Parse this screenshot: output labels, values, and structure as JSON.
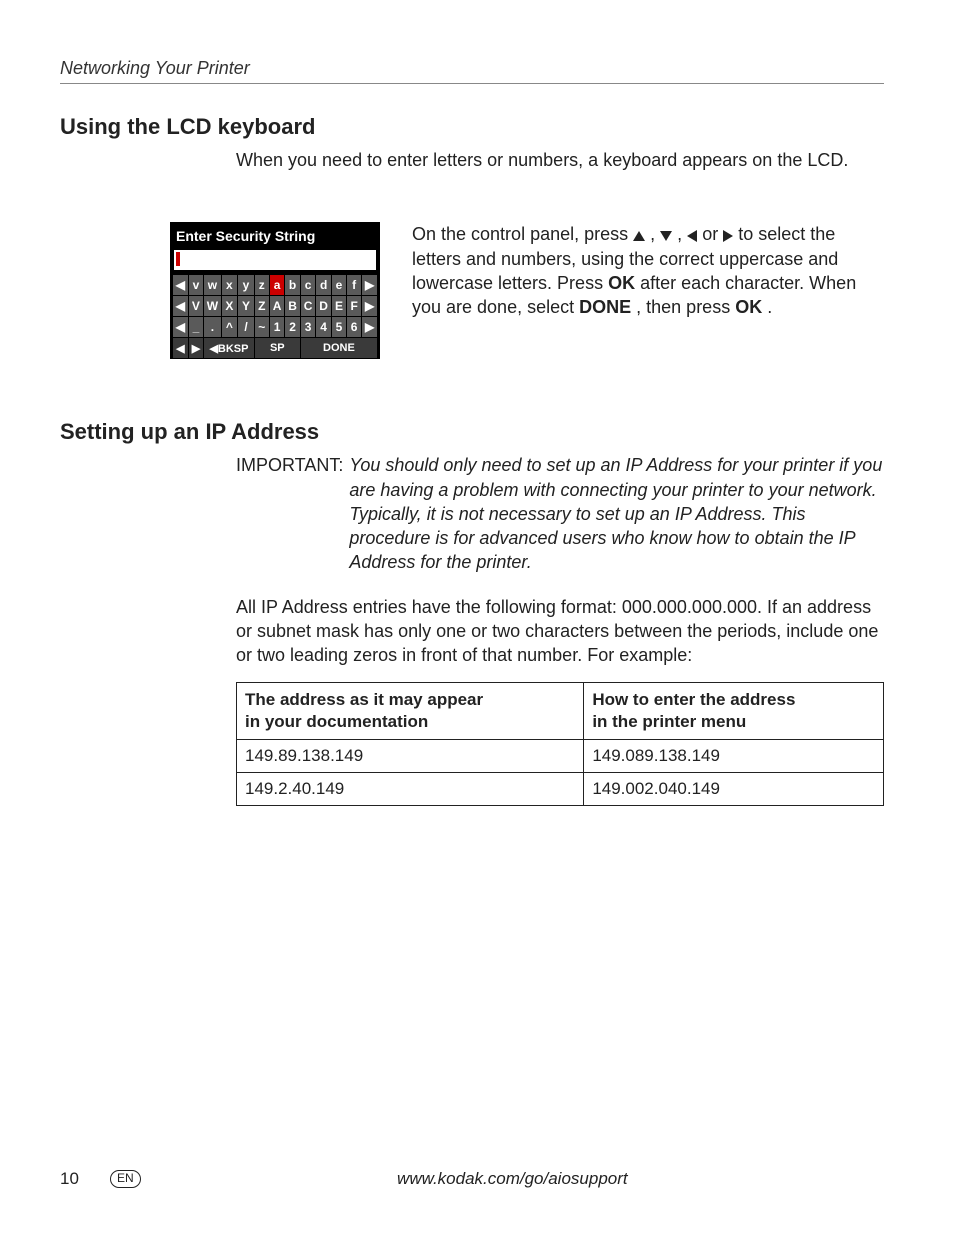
{
  "header": {
    "running_title": "Networking Your Printer"
  },
  "section1": {
    "heading": "Using the LCD keyboard",
    "intro": "When you need to enter letters or numbers, a keyboard appears on the LCD.",
    "lcd": {
      "title": "Enter Security String",
      "row1": [
        "◀",
        "v",
        "w",
        "x",
        "y",
        "z",
        "a",
        "b",
        "c",
        "d",
        "e",
        "f",
        "▶"
      ],
      "row2": [
        "◀",
        "V",
        "W",
        "X",
        "Y",
        "Z",
        "A",
        "B",
        "C",
        "D",
        "E",
        "F",
        "▶"
      ],
      "row3": [
        "◀",
        "_",
        ".",
        "^",
        "/",
        "~",
        "1",
        "2",
        "3",
        "4",
        "5",
        "6",
        "▶"
      ],
      "bottom": {
        "left_arrow": "◀",
        "right_arrow": "▶",
        "bksp": "◀BKSP",
        "sp": "SP",
        "done": "DONE"
      }
    },
    "para": {
      "p1a": "On the control panel, press ",
      "p1b": ", ",
      "p1c": ", ",
      "p1d": " or ",
      "p1e": " to select the letters and numbers, using the correct uppercase and lowercase letters. Press ",
      "ok1": "OK",
      "p1f": " after each character. When you are done, select ",
      "done": "DONE",
      "p1g": ", then press ",
      "ok2": "OK",
      "p1h": "."
    }
  },
  "section2": {
    "heading": "Setting up an IP Address",
    "important_label": "IMPORTANT:",
    "important_text": "You should only need to set up an IP Address for your printer if you are having a problem with connecting your printer to your network. Typically, it is not necessary to set up an IP Address. This procedure is for advanced users who know how to obtain the IP Address for the printer.",
    "body": "All IP Address entries have the following format: 000.000.000.000. If an address or subnet mask has only one or two characters between the periods, include one or two leading zeros in front of that number. For example:",
    "table": {
      "header_left_l1": "The address as it may appear",
      "header_left_l2": "in your documentation",
      "header_right_l1": "How to enter the address",
      "header_right_l2": "in the printer menu",
      "rows": [
        {
          "left": "149.89.138.149",
          "right": "149.089.138.149"
        },
        {
          "left": "149.2.40.149",
          "right": "149.002.040.149"
        }
      ]
    }
  },
  "footer": {
    "page": "10",
    "lang": "EN",
    "url": "www.kodak.com/go/aiosupport"
  }
}
